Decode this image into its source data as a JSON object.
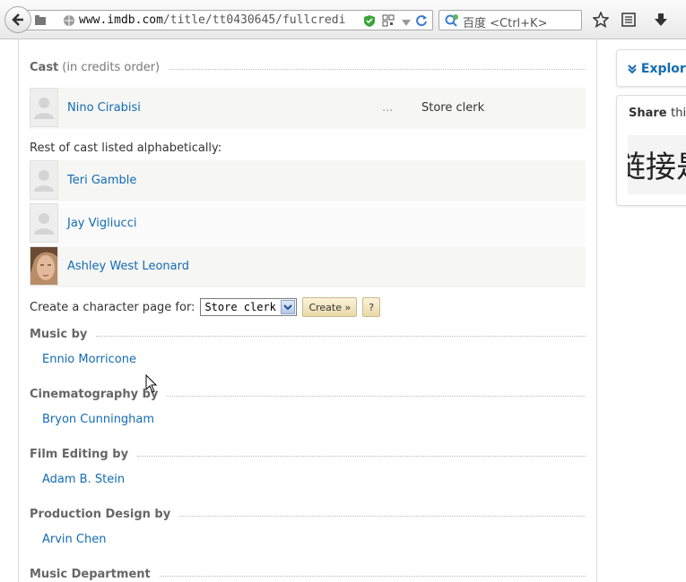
{
  "browser": {
    "url_host": "www.imdb.com",
    "url_path": "/title/tt0430645/fullcredi",
    "search_placeholder": "百度 <Ctrl+K>"
  },
  "cast_header": {
    "title": "Cast",
    "subtitle": "(in credits order)"
  },
  "cast": [
    {
      "name": "Nino Cirabisi",
      "ellipsis": "...",
      "character": "Store clerk"
    }
  ],
  "rest_label": "Rest of cast listed alphabetically:",
  "rest_cast": [
    {
      "name": "Teri Gamble"
    },
    {
      "name": "Jay Vigliucci"
    },
    {
      "name": "Ashley West Leonard"
    }
  ],
  "character_page": {
    "label": "Create a character page for:",
    "selected": "Store clerk",
    "create_label": "Create »",
    "help_label": "?"
  },
  "crew": [
    {
      "header": "Music by",
      "name": "Ennio Morricone"
    },
    {
      "header": "Cinematography by",
      "name": "Bryon Cunningham"
    },
    {
      "header": "Film Editing by",
      "name": "Adam B. Stein"
    },
    {
      "header": "Production Design by",
      "name": "Arvin Chen"
    },
    {
      "header": "Music Department",
      "name": ""
    }
  ],
  "sidebar": {
    "explore": "Explore",
    "share_title": "Share",
    "share_suffix": "thi",
    "share_image_text": "链接是"
  },
  "colors": {
    "link": "#136cb2",
    "row_odd": "#f6f6f5",
    "row_even": "#fbfbfb"
  }
}
